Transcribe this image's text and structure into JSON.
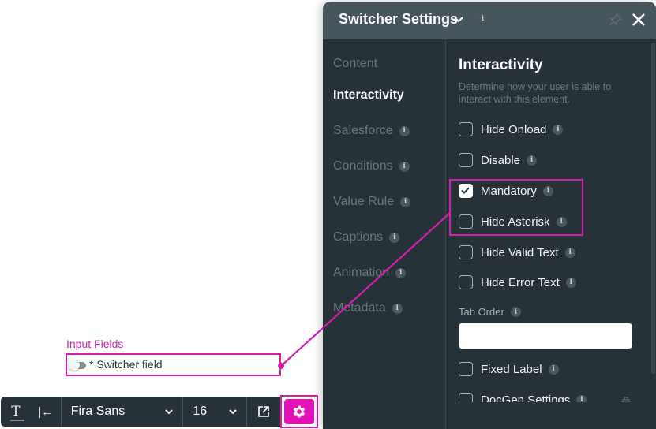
{
  "canvas": {
    "section_label": "Input Fields",
    "field_text": "* Switcher field",
    "switch_on": false
  },
  "toolbar": {
    "text_icon": "T",
    "indent_icon": "|←",
    "font_family": "Fira Sans",
    "font_size": "16"
  },
  "panel": {
    "title": "Switcher Settings",
    "info": "i",
    "nav": [
      {
        "label": "Content",
        "info": false,
        "active": false
      },
      {
        "label": "Interactivity",
        "info": false,
        "active": true
      },
      {
        "label": "Salesforce",
        "info": true,
        "active": false
      },
      {
        "label": "Conditions",
        "info": true,
        "active": false
      },
      {
        "label": "Value Rule",
        "info": true,
        "active": false
      },
      {
        "label": "Captions",
        "info": true,
        "active": false
      },
      {
        "label": "Animation",
        "info": true,
        "active": false
      },
      {
        "label": "Metadata",
        "info": true,
        "active": false
      }
    ],
    "section": {
      "title": "Interactivity",
      "description": "Determine how your user is able to interact with this element.",
      "options": [
        {
          "label": "Hide Onload",
          "checked": false
        },
        {
          "label": "Disable",
          "checked": false
        },
        {
          "label": "Mandatory",
          "checked": true
        },
        {
          "label": "Hide Asterisk",
          "checked": false
        },
        {
          "label": "Hide Valid Text",
          "checked": false
        },
        {
          "label": "Hide Error Text",
          "checked": false
        }
      ],
      "tab_order_label": "Tab Order",
      "tab_order_value": "",
      "fixed_label": {
        "label": "Fixed Label",
        "checked": false
      },
      "docgen": {
        "label": "DocGen Settings",
        "checked": false
      }
    }
  },
  "colors": {
    "highlight": "#d21fb0",
    "panel_bg": "#263238",
    "header_bg": "#47555c",
    "gear_bg": "#e211b8"
  }
}
